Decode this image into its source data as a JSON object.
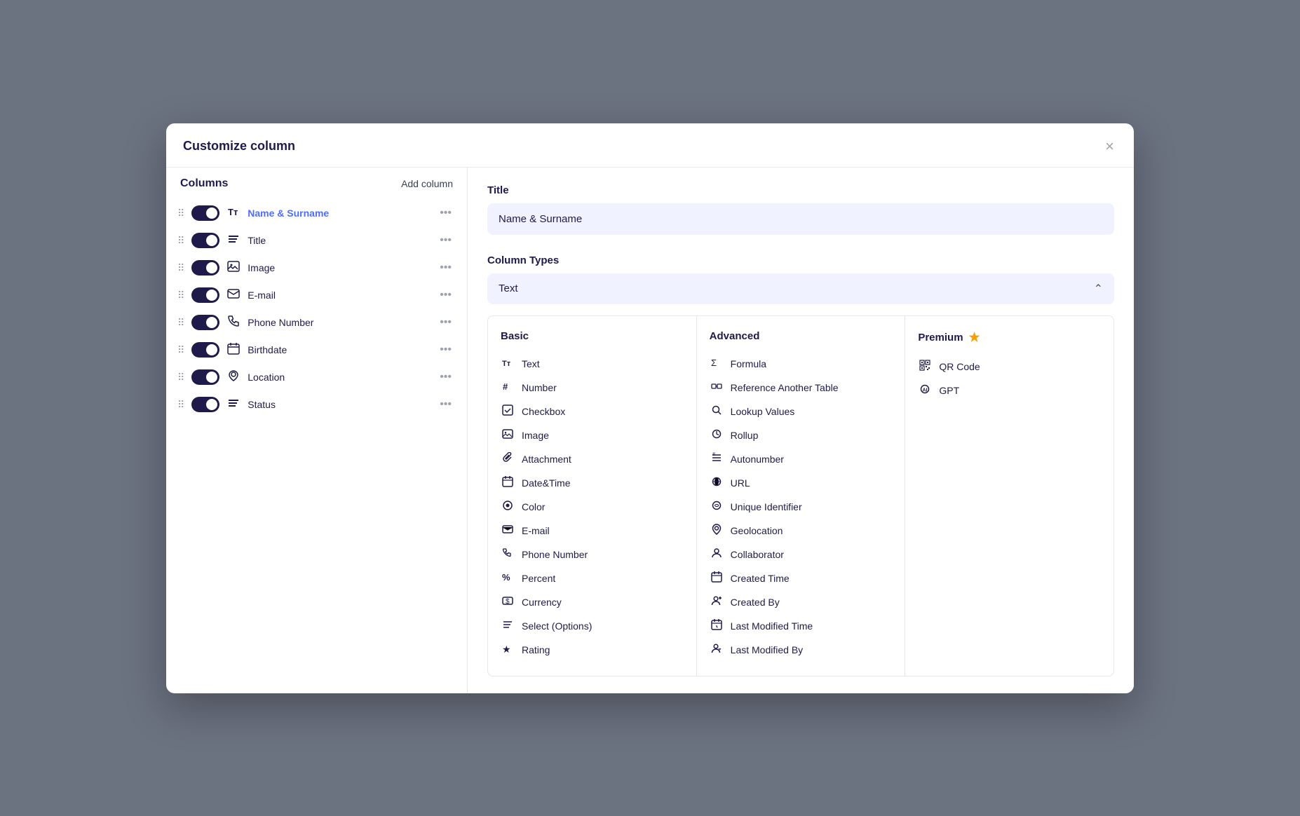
{
  "modal": {
    "title": "Customize column",
    "close_label": "×"
  },
  "left_panel": {
    "title": "Columns",
    "add_column_label": "Add column",
    "columns": [
      {
        "id": "name-surname",
        "icon": "Tт",
        "icon_type": "text",
        "label": "Name & Surname",
        "active": true
      },
      {
        "id": "title",
        "icon": "≡",
        "icon_type": "list",
        "label": "Title",
        "active": false
      },
      {
        "id": "image",
        "icon": "🖼",
        "icon_type": "image",
        "label": "Image",
        "active": false
      },
      {
        "id": "email",
        "icon": "✉",
        "icon_type": "email",
        "label": "E-mail",
        "active": false
      },
      {
        "id": "phone",
        "icon": "📞",
        "icon_type": "phone",
        "label": "Phone Number",
        "active": false
      },
      {
        "id": "birthdate",
        "icon": "📅",
        "icon_type": "date",
        "label": "Birthdate",
        "active": false
      },
      {
        "id": "location",
        "icon": "📍",
        "icon_type": "location",
        "label": "Location",
        "active": false
      },
      {
        "id": "status",
        "icon": "≡",
        "icon_type": "list",
        "label": "Status",
        "active": false
      }
    ]
  },
  "right_panel": {
    "title_section_label": "Title",
    "title_value": "Name & Surname",
    "column_types_label": "Column Types",
    "selected_type": "Text",
    "basic": {
      "header": "Basic",
      "items": [
        {
          "icon": "Tт",
          "label": "Text"
        },
        {
          "icon": "#",
          "label": "Number"
        },
        {
          "icon": "☑",
          "label": "Checkbox"
        },
        {
          "icon": "🖼",
          "label": "Image"
        },
        {
          "icon": "📎",
          "label": "Attachment"
        },
        {
          "icon": "📅",
          "label": "Date&Time"
        },
        {
          "icon": "🎨",
          "label": "Color"
        },
        {
          "icon": "✉",
          "label": "E-mail"
        },
        {
          "icon": "📞",
          "label": "Phone Number"
        },
        {
          "icon": "%",
          "label": "Percent"
        },
        {
          "icon": "💰",
          "label": "Currency"
        },
        {
          "icon": "≡",
          "label": "Select (Options)"
        },
        {
          "icon": "★",
          "label": "Rating"
        }
      ]
    },
    "advanced": {
      "header": "Advanced",
      "items": [
        {
          "icon": "Σ",
          "label": "Formula"
        },
        {
          "icon": "🔗",
          "label": "Reference Another Table"
        },
        {
          "icon": "🔍",
          "label": "Lookup Values"
        },
        {
          "icon": "⟳",
          "label": "Rollup"
        },
        {
          "icon": "≡#",
          "label": "Autonumber"
        },
        {
          "icon": "🌐",
          "label": "URL"
        },
        {
          "icon": "🔑",
          "label": "Unique Identifier"
        },
        {
          "icon": "📍",
          "label": "Geolocation"
        },
        {
          "icon": "👤",
          "label": "Collaborator"
        },
        {
          "icon": "📅",
          "label": "Created Time"
        },
        {
          "icon": "👤+",
          "label": "Created By"
        },
        {
          "icon": "📅✏",
          "label": "Last Modified Time"
        },
        {
          "icon": "👤✏",
          "label": "Last Modified By"
        }
      ]
    },
    "premium": {
      "header": "Premium",
      "items": [
        {
          "icon": "▦",
          "label": "QR Code"
        },
        {
          "icon": "⊙",
          "label": "GPT"
        }
      ]
    }
  }
}
